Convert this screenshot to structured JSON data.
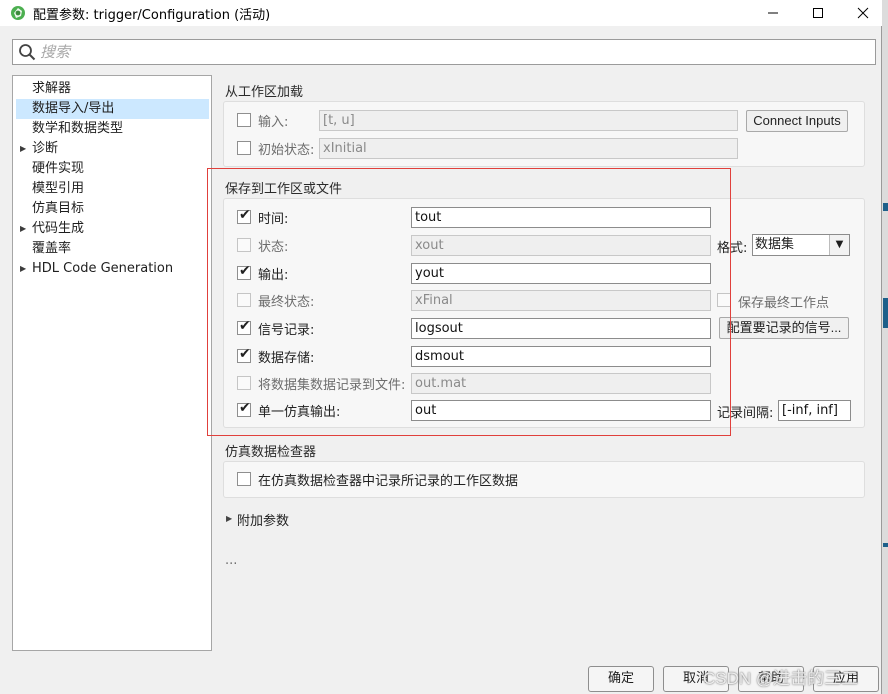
{
  "window": {
    "title": "配置参数: trigger/Configuration (活动)",
    "controls": {
      "minimize_icon": "minimize-icon",
      "maximize_icon": "maximize-icon",
      "close_icon": "close-icon"
    }
  },
  "search": {
    "placeholder": "搜索",
    "icon": "search-icon"
  },
  "tree": {
    "items": [
      {
        "label": "求解器",
        "expandable": false,
        "selected": false
      },
      {
        "label": "数据导入/导出",
        "expandable": false,
        "selected": true
      },
      {
        "label": "数学和数据类型",
        "expandable": false,
        "selected": false
      },
      {
        "label": "诊断",
        "expandable": true,
        "selected": false
      },
      {
        "label": "硬件实现",
        "expandable": false,
        "selected": false
      },
      {
        "label": "模型引用",
        "expandable": false,
        "selected": false
      },
      {
        "label": "仿真目标",
        "expandable": false,
        "selected": false
      },
      {
        "label": "代码生成",
        "expandable": true,
        "selected": false
      },
      {
        "label": "覆盖率",
        "expandable": false,
        "selected": false
      },
      {
        "label": "HDL Code Generation",
        "expandable": true,
        "selected": false
      }
    ]
  },
  "load": {
    "title": "从工作区加载",
    "input": {
      "label": "输入:",
      "checked": false,
      "value": "[t, u]"
    },
    "connect_button": "Connect Inputs",
    "initial_state": {
      "label": "初始状态:",
      "checked": false,
      "value": "xInitial"
    }
  },
  "save": {
    "title": "保存到工作区或文件",
    "time": {
      "label": "时间:",
      "checked": true,
      "value": "tout"
    },
    "states": {
      "label": "状态:",
      "checked": false,
      "value": "xout"
    },
    "format_label": "格式:",
    "format_value": "数据集",
    "output": {
      "label": "输出:",
      "checked": true,
      "value": "yout"
    },
    "final_states": {
      "label": "最终状态:",
      "checked": false,
      "value": "xFinal"
    },
    "save_final_op": {
      "label": "保存最终工作点",
      "checked": false
    },
    "signal_logging": {
      "label": "信号记录:",
      "checked": true,
      "value": "logsout"
    },
    "configure_signals_button": "配置要记录的信号...",
    "data_stores": {
      "label": "数据存储:",
      "checked": true,
      "value": "dsmout"
    },
    "log_dataset": {
      "label": "将数据集数据记录到文件:",
      "checked": false,
      "value": "out.mat"
    },
    "single_output": {
      "label": "单一仿真输出:",
      "checked": true,
      "value": "out"
    },
    "interval_label": "记录间隔:",
    "interval_value": "[-inf, inf]"
  },
  "sdi": {
    "title": "仿真数据检查器",
    "record": {
      "label": "在仿真数据检查器中记录所记录的工作区数据",
      "checked": false
    }
  },
  "additional": {
    "label": "附加参数",
    "ellipsis": "..."
  },
  "footer": {
    "ok": "确定",
    "cancel": "取消",
    "help": "帮助",
    "apply": "应用"
  },
  "watermark": "CSDN @进击的三二",
  "colors": {
    "selection": "#cce8ff",
    "highlight_box": "#e0403c",
    "app_icon": "#3c9a3c"
  }
}
